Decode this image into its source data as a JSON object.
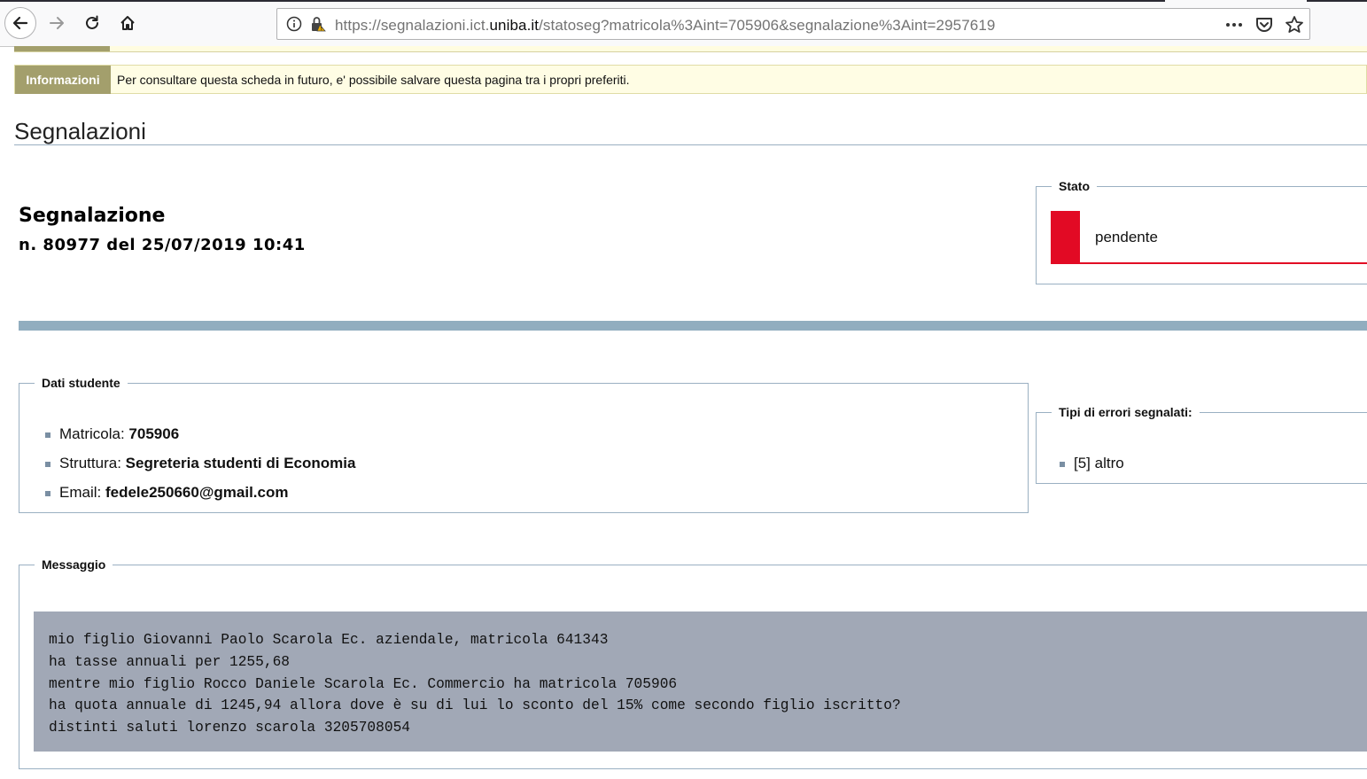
{
  "browser": {
    "url_prefix": "https://segnalazioni.ict.",
    "url_domain": "uniba.it",
    "url_path": "/statoseg?matricola%3Aint=705906&segnalazione%3Aint=2957619"
  },
  "info_bar": {
    "label": "Informazioni",
    "text": "Per consultare questa scheda in futuro, e' possibile salvare questa pagina tra i propri preferiti."
  },
  "page": {
    "title": "Segnalazioni"
  },
  "segnalazione": {
    "title": "Segnalazione",
    "subtitle": "n. 80977 del 25/07/2019 10:41"
  },
  "stato": {
    "legend": "Stato",
    "value": "pendente",
    "color": "#e20a24"
  },
  "dati_studente": {
    "legend": "Dati studente",
    "items": [
      {
        "label": "Matricola:",
        "value": "705906"
      },
      {
        "label": "Struttura:",
        "value": "Segreteria studenti di Economia"
      },
      {
        "label": "Email:",
        "value": "fedele250660@gmail.com"
      }
    ]
  },
  "tipi_errori": {
    "legend": "Tipi di errori segnalati:",
    "items": [
      "[5] altro"
    ]
  },
  "messaggio": {
    "legend": "Messaggio",
    "lines": [
      "mio figlio Giovanni Paolo Scarola Ec. aziendale, matricola 641343",
      "ha tasse annuali per 1255,68",
      "mentre mio figlio Rocco Daniele Scarola Ec. Commercio ha matricola 705906",
      "ha quota annuale di 1245,94 allora dove è su di lui lo sconto del 15% come secondo figlio iscritto?",
      "distinti saluti lorenzo scarola 3205708054"
    ]
  },
  "icons": {
    "back": "back-arrow-icon",
    "forward": "forward-arrow-icon",
    "reload": "reload-icon",
    "home": "home-icon",
    "info": "info-icon",
    "lock": "insecure-lock-icon",
    "more": "more-icon",
    "pocket": "pocket-icon",
    "bookmark": "bookmark-star-icon"
  }
}
